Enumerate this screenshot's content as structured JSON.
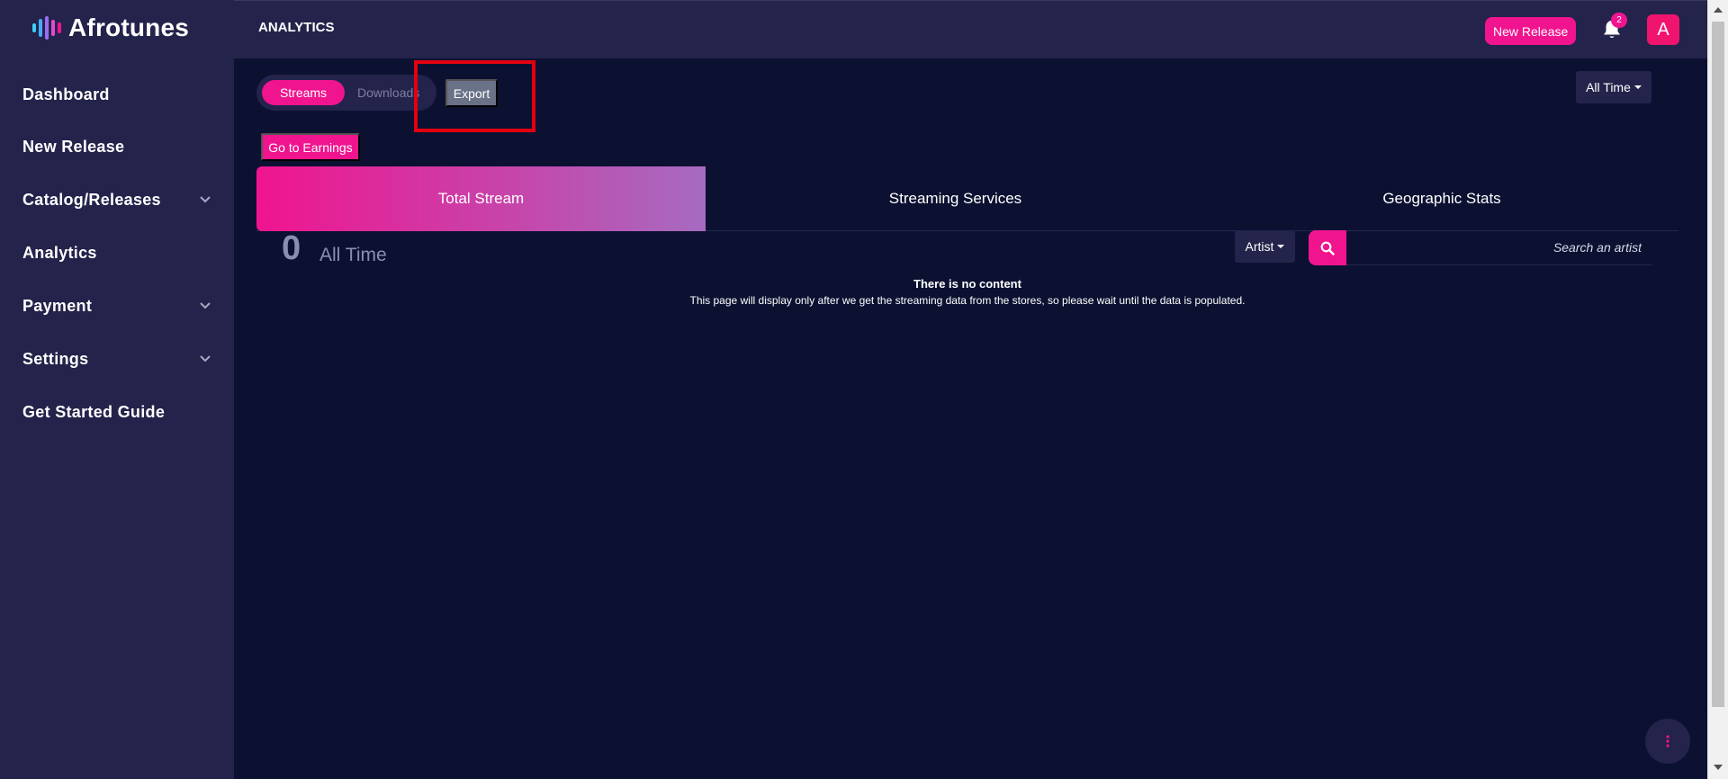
{
  "app": {
    "name": "Afrotunes"
  },
  "sidebar": {
    "items": [
      {
        "label": "Dashboard",
        "has_submenu": false
      },
      {
        "label": "New Release",
        "has_submenu": false
      },
      {
        "label": "Catalog/Releases",
        "has_submenu": true
      },
      {
        "label": "Analytics",
        "has_submenu": false
      },
      {
        "label": "Payment",
        "has_submenu": true
      },
      {
        "label": "Settings",
        "has_submenu": true
      },
      {
        "label": "Get Started Guide",
        "has_submenu": false
      }
    ]
  },
  "header": {
    "title": "ANALYTICS",
    "new_release_label": "New Release",
    "notification_count": "2",
    "avatar_initial": "A"
  },
  "main": {
    "toggle": {
      "streams_label": "Streams",
      "downloads_label": "Downloads",
      "selected": "Streams"
    },
    "export_label": "Export",
    "period_dropdown_label": "All Time",
    "earnings_button_label": "Go to Earnings",
    "tabs": [
      {
        "label": "Total Stream",
        "active": true
      },
      {
        "label": "Streaming Services",
        "active": false
      },
      {
        "label": "Geographic Stats",
        "active": false
      }
    ],
    "stats": {
      "count": "0",
      "period": "All Time"
    },
    "filter_label": "Artist",
    "search": {
      "placeholder": "Search an artist",
      "value": ""
    },
    "empty_state": {
      "title": "There is no content",
      "message": "This page will display only after we get the streaming data from the stores, so please wait until the data is populated."
    }
  },
  "colors": {
    "accent": "#f0148f",
    "sidebar_bg": "#23234b",
    "content_bg": "#0c1132",
    "export_bg": "#6a7288",
    "highlight": "#e3000f"
  }
}
